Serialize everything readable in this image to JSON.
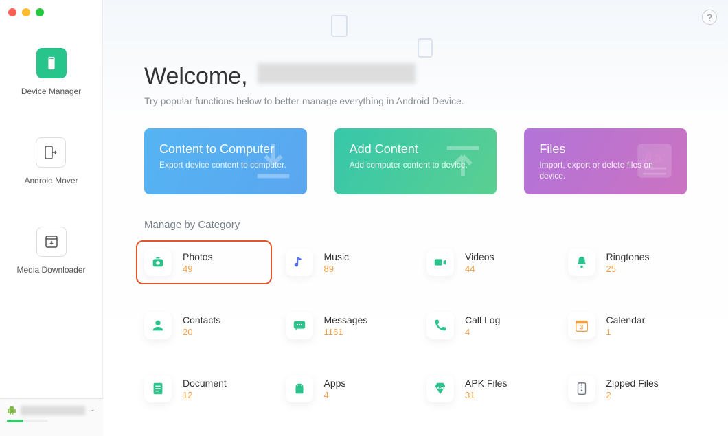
{
  "window": {
    "sidebar": [
      {
        "id": "device-manager",
        "label": "Device Manager"
      },
      {
        "id": "android-mover",
        "label": "Android Mover"
      },
      {
        "id": "media-downloader",
        "label": "Media Downloader"
      }
    ],
    "device": {
      "name_redacted": true,
      "storage_used_pct": 40
    }
  },
  "main": {
    "welcome_label": "Welcome,",
    "subtitle": "Try popular functions below to better manage everything in Android Device.",
    "help_tooltip": "?",
    "cards": [
      {
        "id": "content-to-computer",
        "title": "Content to Computer",
        "sub": "Export device content to computer.",
        "color": "blue"
      },
      {
        "id": "add-content",
        "title": "Add Content",
        "sub": "Add computer content to device.",
        "color": "green"
      },
      {
        "id": "files",
        "title": "Files",
        "sub": "Import, export or delete files on device.",
        "color": "purple"
      }
    ],
    "category_section_title": "Manage by Category",
    "categories": [
      {
        "id": "photos",
        "label": "Photos",
        "count": "49",
        "icon": "camera",
        "color": "#2bc28b",
        "highlighted": true
      },
      {
        "id": "music",
        "label": "Music",
        "count": "89",
        "icon": "music",
        "color": "#4f6ef0"
      },
      {
        "id": "videos",
        "label": "Videos",
        "count": "44",
        "icon": "video",
        "color": "#2bc28b"
      },
      {
        "id": "ringtones",
        "label": "Ringtones",
        "count": "25",
        "icon": "bell",
        "color": "#2bc28b"
      },
      {
        "id": "contacts",
        "label": "Contacts",
        "count": "20",
        "icon": "person",
        "color": "#2bc28b"
      },
      {
        "id": "messages",
        "label": "Messages",
        "count": "1161",
        "icon": "message",
        "color": "#2bc28b"
      },
      {
        "id": "calllog",
        "label": "Call Log",
        "count": "4",
        "icon": "phone",
        "color": "#2bc28b"
      },
      {
        "id": "calendar",
        "label": "Calendar",
        "count": "1",
        "icon": "calendar",
        "color": "#f1a04a"
      },
      {
        "id": "document",
        "label": "Document",
        "count": "12",
        "icon": "doc",
        "color": "#2bc28b"
      },
      {
        "id": "apps",
        "label": "Apps",
        "count": "4",
        "icon": "android",
        "color": "#2bc28b"
      },
      {
        "id": "apk",
        "label": "APK Files",
        "count": "31",
        "icon": "apk",
        "color": "#2bc28b"
      },
      {
        "id": "zipped",
        "label": "Zipped Files",
        "count": "2",
        "icon": "zip",
        "color": "#6b7280"
      }
    ]
  }
}
